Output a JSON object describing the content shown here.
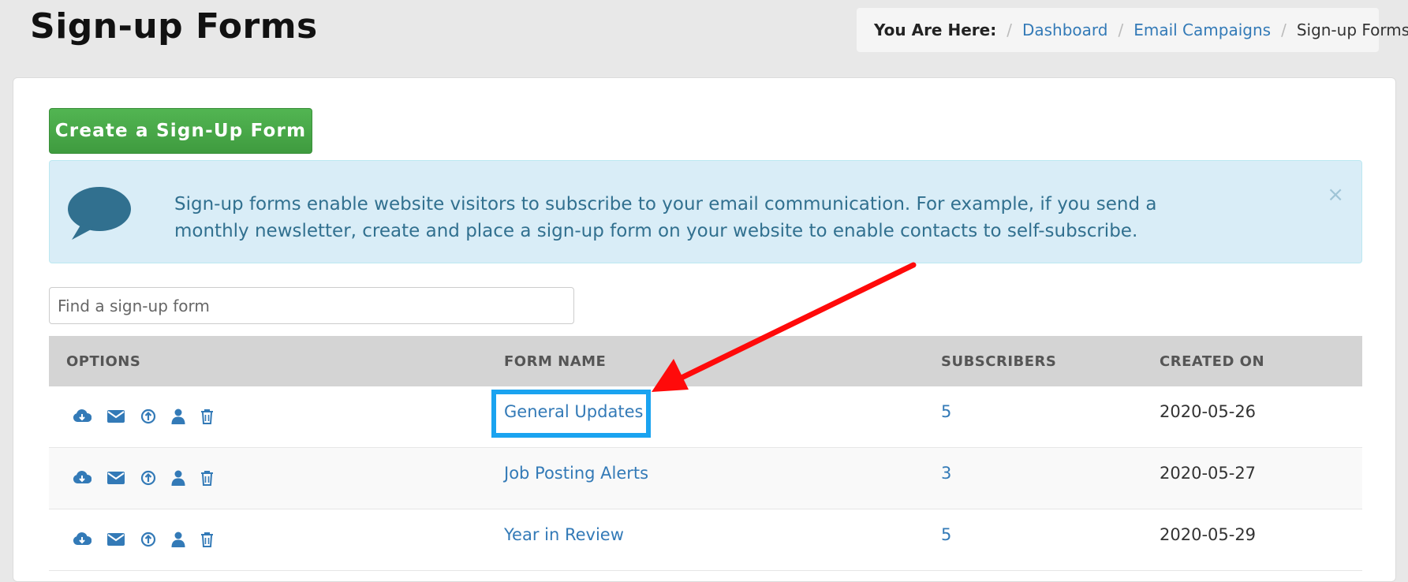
{
  "header": {
    "title": "Sign-up Forms"
  },
  "breadcrumb": {
    "lead": "You Are Here:",
    "items": [
      "Dashboard",
      "Email Campaigns"
    ],
    "current": "Sign-up Forms"
  },
  "toolbar": {
    "create_label": "Create a Sign-Up Form"
  },
  "alert": {
    "message": "Sign-up forms enable website visitors to subscribe to your email communication. For example, if you send a monthly newsletter, create and place a sign-up form on your website to enable contacts to self-subscribe.",
    "close_glyph": "×",
    "icon": "speech-bubble-icon"
  },
  "search": {
    "placeholder": "Find a sign-up form",
    "value": ""
  },
  "table": {
    "columns": [
      "OPTIONS",
      "FORM NAME",
      "SUBSCRIBERS",
      "CREATED ON"
    ],
    "option_icons": [
      "download-cloud-icon",
      "envelope-icon",
      "upload-circle-icon",
      "user-icon",
      "trash-icon"
    ],
    "rows": [
      {
        "name": "General Updates",
        "subscribers": "5",
        "created": "2020-05-26"
      },
      {
        "name": "Job Posting Alerts",
        "subscribers": "3",
        "created": "2020-05-27"
      },
      {
        "name": "Year in Review",
        "subscribers": "5",
        "created": "2020-05-29"
      }
    ]
  },
  "colors": {
    "link": "#337ab7",
    "create_button": "#45a845",
    "alert_bg": "#d9edf7",
    "alert_text": "#31708f",
    "annotation_arrow": "#ff0a0a",
    "annotation_box": "#1aa3f0"
  }
}
